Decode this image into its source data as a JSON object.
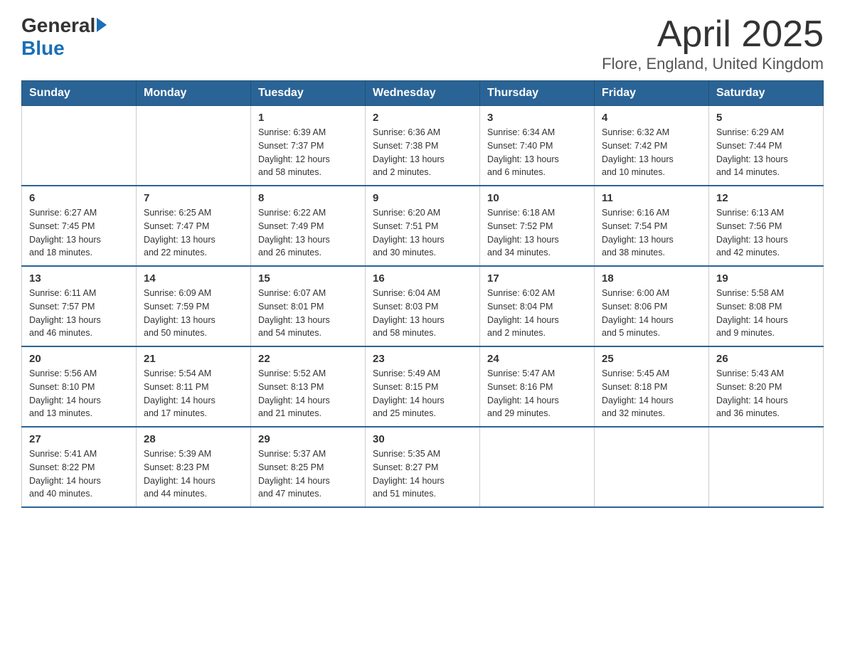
{
  "header": {
    "logo_general": "General",
    "logo_blue": "Blue",
    "title": "April 2025",
    "location": "Flore, England, United Kingdom"
  },
  "calendar": {
    "headers": [
      "Sunday",
      "Monday",
      "Tuesday",
      "Wednesday",
      "Thursday",
      "Friday",
      "Saturday"
    ],
    "weeks": [
      [
        {
          "day": "",
          "info": ""
        },
        {
          "day": "",
          "info": ""
        },
        {
          "day": "1",
          "info": "Sunrise: 6:39 AM\nSunset: 7:37 PM\nDaylight: 12 hours\nand 58 minutes."
        },
        {
          "day": "2",
          "info": "Sunrise: 6:36 AM\nSunset: 7:38 PM\nDaylight: 13 hours\nand 2 minutes."
        },
        {
          "day": "3",
          "info": "Sunrise: 6:34 AM\nSunset: 7:40 PM\nDaylight: 13 hours\nand 6 minutes."
        },
        {
          "day": "4",
          "info": "Sunrise: 6:32 AM\nSunset: 7:42 PM\nDaylight: 13 hours\nand 10 minutes."
        },
        {
          "day": "5",
          "info": "Sunrise: 6:29 AM\nSunset: 7:44 PM\nDaylight: 13 hours\nand 14 minutes."
        }
      ],
      [
        {
          "day": "6",
          "info": "Sunrise: 6:27 AM\nSunset: 7:45 PM\nDaylight: 13 hours\nand 18 minutes."
        },
        {
          "day": "7",
          "info": "Sunrise: 6:25 AM\nSunset: 7:47 PM\nDaylight: 13 hours\nand 22 minutes."
        },
        {
          "day": "8",
          "info": "Sunrise: 6:22 AM\nSunset: 7:49 PM\nDaylight: 13 hours\nand 26 minutes."
        },
        {
          "day": "9",
          "info": "Sunrise: 6:20 AM\nSunset: 7:51 PM\nDaylight: 13 hours\nand 30 minutes."
        },
        {
          "day": "10",
          "info": "Sunrise: 6:18 AM\nSunset: 7:52 PM\nDaylight: 13 hours\nand 34 minutes."
        },
        {
          "day": "11",
          "info": "Sunrise: 6:16 AM\nSunset: 7:54 PM\nDaylight: 13 hours\nand 38 minutes."
        },
        {
          "day": "12",
          "info": "Sunrise: 6:13 AM\nSunset: 7:56 PM\nDaylight: 13 hours\nand 42 minutes."
        }
      ],
      [
        {
          "day": "13",
          "info": "Sunrise: 6:11 AM\nSunset: 7:57 PM\nDaylight: 13 hours\nand 46 minutes."
        },
        {
          "day": "14",
          "info": "Sunrise: 6:09 AM\nSunset: 7:59 PM\nDaylight: 13 hours\nand 50 minutes."
        },
        {
          "day": "15",
          "info": "Sunrise: 6:07 AM\nSunset: 8:01 PM\nDaylight: 13 hours\nand 54 minutes."
        },
        {
          "day": "16",
          "info": "Sunrise: 6:04 AM\nSunset: 8:03 PM\nDaylight: 13 hours\nand 58 minutes."
        },
        {
          "day": "17",
          "info": "Sunrise: 6:02 AM\nSunset: 8:04 PM\nDaylight: 14 hours\nand 2 minutes."
        },
        {
          "day": "18",
          "info": "Sunrise: 6:00 AM\nSunset: 8:06 PM\nDaylight: 14 hours\nand 5 minutes."
        },
        {
          "day": "19",
          "info": "Sunrise: 5:58 AM\nSunset: 8:08 PM\nDaylight: 14 hours\nand 9 minutes."
        }
      ],
      [
        {
          "day": "20",
          "info": "Sunrise: 5:56 AM\nSunset: 8:10 PM\nDaylight: 14 hours\nand 13 minutes."
        },
        {
          "day": "21",
          "info": "Sunrise: 5:54 AM\nSunset: 8:11 PM\nDaylight: 14 hours\nand 17 minutes."
        },
        {
          "day": "22",
          "info": "Sunrise: 5:52 AM\nSunset: 8:13 PM\nDaylight: 14 hours\nand 21 minutes."
        },
        {
          "day": "23",
          "info": "Sunrise: 5:49 AM\nSunset: 8:15 PM\nDaylight: 14 hours\nand 25 minutes."
        },
        {
          "day": "24",
          "info": "Sunrise: 5:47 AM\nSunset: 8:16 PM\nDaylight: 14 hours\nand 29 minutes."
        },
        {
          "day": "25",
          "info": "Sunrise: 5:45 AM\nSunset: 8:18 PM\nDaylight: 14 hours\nand 32 minutes."
        },
        {
          "day": "26",
          "info": "Sunrise: 5:43 AM\nSunset: 8:20 PM\nDaylight: 14 hours\nand 36 minutes."
        }
      ],
      [
        {
          "day": "27",
          "info": "Sunrise: 5:41 AM\nSunset: 8:22 PM\nDaylight: 14 hours\nand 40 minutes."
        },
        {
          "day": "28",
          "info": "Sunrise: 5:39 AM\nSunset: 8:23 PM\nDaylight: 14 hours\nand 44 minutes."
        },
        {
          "day": "29",
          "info": "Sunrise: 5:37 AM\nSunset: 8:25 PM\nDaylight: 14 hours\nand 47 minutes."
        },
        {
          "day": "30",
          "info": "Sunrise: 5:35 AM\nSunset: 8:27 PM\nDaylight: 14 hours\nand 51 minutes."
        },
        {
          "day": "",
          "info": ""
        },
        {
          "day": "",
          "info": ""
        },
        {
          "day": "",
          "info": ""
        }
      ]
    ]
  }
}
